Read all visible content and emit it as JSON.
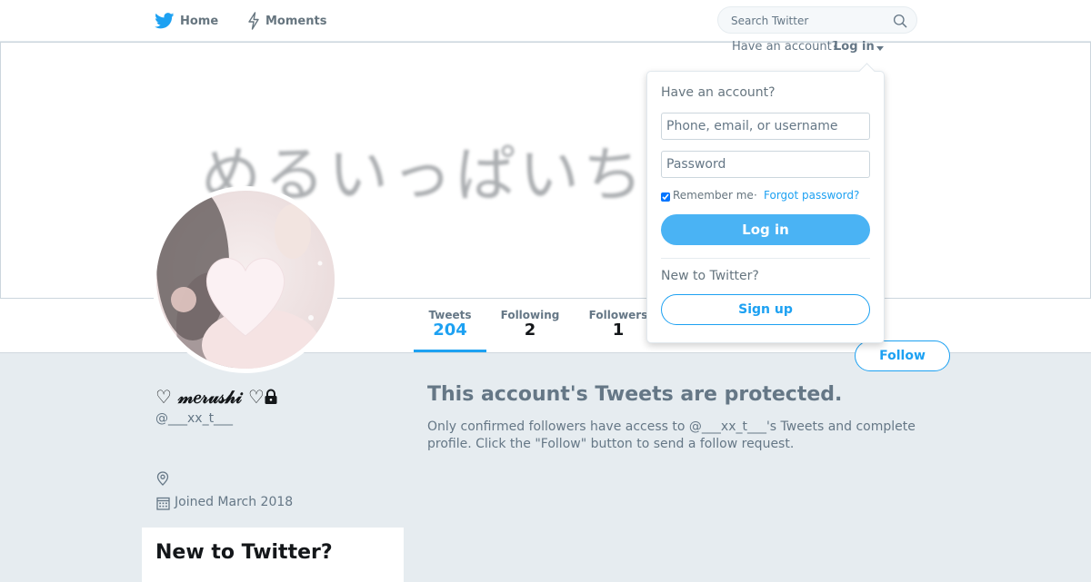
{
  "nav": {
    "home_label": "Home",
    "moments_label": "Moments",
    "search_placeholder": "Search Twitter",
    "home_icon": "twitter-bird-icon",
    "moments_icon": "lightning-icon",
    "search_icon": "search-icon"
  },
  "banner": {
    "text": "めるいっぱいち"
  },
  "profile": {
    "name": "♡ 𝓂𝑒𝓇𝓊𝓈𝒽𝒾 ♡",
    "screen_name": "@___xx_t___",
    "joined": "Joined March 2018",
    "protected": true
  },
  "stats": [
    {
      "label": "Tweets",
      "value": "204",
      "active": true
    },
    {
      "label": "Following",
      "value": "2"
    },
    {
      "label": "Followers",
      "value": "1"
    }
  ],
  "follow_label": "Follow",
  "protected_notice": {
    "title": "This account's Tweets are protected.",
    "body": "Only confirmed followers have access to @___xx_t___'s Tweets and complete profile. Click the \"Follow\" button to send a follow request."
  },
  "sidebar_card": {
    "title": "New to Twitter?"
  },
  "login": {
    "have_account_text": "Have an account?",
    "toggle_label": "Log in",
    "dropdown_title": "Have an account?",
    "username_placeholder": "Phone, email, or username",
    "password_placeholder": "Password",
    "remember_label": "Remember me",
    "remember_checked": true,
    "separator": "·",
    "forgot_label": "Forgot password?",
    "button_label": "Log in",
    "new_label": "New to Twitter?",
    "signup_label": "Sign up"
  },
  "colors": {
    "accent": "#1da1f2",
    "background": "#e6ecf0",
    "muted_text": "#657786"
  }
}
